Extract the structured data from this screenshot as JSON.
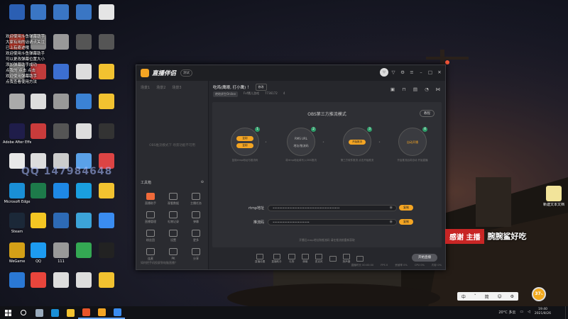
{
  "desktop": {
    "icons_col1": [
      {
        "label": "",
        "color": "#2b5fb3"
      },
      {
        "label": "",
        "color": "#c0392b"
      },
      {
        "label": "",
        "color": "#888"
      },
      {
        "label": "",
        "color": "#aaa"
      },
      {
        "label": "Adobe After Effects 2020",
        "color": "#1f1d4a"
      },
      {
        "label": "",
        "color": "#e8e8e8"
      },
      {
        "label": "Microsoft Edge",
        "color": "#1a8fd6"
      },
      {
        "label": "Steam",
        "color": "#1b2838"
      },
      {
        "label": "WeGame",
        "color": "#d4a017"
      },
      {
        "label": "",
        "color": "#2a78d4"
      }
    ],
    "icons_col2": [
      {
        "label": "",
        "color": "#3a76c4"
      },
      {
        "label": "",
        "color": "#888"
      },
      {
        "label": "",
        "color": "#c13b3b"
      },
      {
        "label": "",
        "color": "#ddd"
      },
      {
        "label": "",
        "color": "#c93b3b"
      },
      {
        "label": "",
        "color": "#ddd"
      },
      {
        "label": "",
        "color": "#1d7a4a"
      },
      {
        "label": "",
        "color": "#f3c623"
      },
      {
        "label": "QQ",
        "color": "#1d9bf0"
      },
      {
        "label": "",
        "color": "#e8453c"
      }
    ],
    "icons_col3": [
      {
        "label": "",
        "color": "#3a76c4"
      },
      {
        "label": "",
        "color": "#999"
      },
      {
        "label": "",
        "color": "#3c6fd1"
      },
      {
        "label": "",
        "color": "#999"
      },
      {
        "label": "",
        "color": "#555"
      },
      {
        "label": "",
        "color": "#ccc"
      },
      {
        "label": "",
        "color": "#1e88e5"
      },
      {
        "label": "",
        "color": "#2d6ab5"
      },
      {
        "label": "111",
        "color": "#999"
      },
      {
        "label": "",
        "color": "#ddd"
      }
    ],
    "icons_col4": [
      {
        "label": "",
        "color": "#3a76c4"
      },
      {
        "label": "",
        "color": "#555"
      },
      {
        "label": "",
        "color": "#ddd"
      },
      {
        "label": "",
        "color": "#3b82d4"
      },
      {
        "label": "",
        "color": "#ddd"
      },
      {
        "label": "",
        "color": "#5aa1e8"
      },
      {
        "label": "",
        "color": "#1a9fe0"
      },
      {
        "label": "",
        "color": "#3ca3d8"
      },
      {
        "label": "",
        "color": "#34a853"
      },
      {
        "label": "",
        "color": "#ddd"
      }
    ],
    "icons_col5": [
      {
        "label": "",
        "color": "#e5e5e5"
      },
      {
        "label": "",
        "color": "#555"
      },
      {
        "label": "",
        "color": "#f2c230"
      },
      {
        "label": "",
        "color": "#f2c230"
      },
      {
        "label": "",
        "color": "#333"
      },
      {
        "label": "",
        "color": "#d44"
      },
      {
        "label": "",
        "color": "#f2c230"
      },
      {
        "label": "",
        "color": "#3a8cf0"
      },
      {
        "label": "",
        "color": "#222"
      },
      {
        "label": "",
        "color": "#f2c230"
      }
    ],
    "notes": [
      "欢迎使用斗鱼弹幕助手",
      "大家有用的话请点关注",
      "已上有奇迹哦",
      "欢迎使用斗鱼弹幕助手",
      "可以更改弹幕位置大小",
      "添加弹幕助手成功",
      "点我的 点击 点击",
      "欢迎使用弹幕助手",
      "点我查看使用方法"
    ],
    "qq_watermark": "QQ 147984648",
    "right_folder_label": "新建文本文档"
  },
  "app": {
    "logo_text": "直播伴侣",
    "version": "测试",
    "scene_tabs": [
      "场景1",
      "场景2",
      "场景3"
    ],
    "scene_empty": "OBS推流模式下 场景功能不可用",
    "tools_header": "工具箱",
    "tools": [
      {
        "label": "直播助手",
        "hot": true
      },
      {
        "label": "观看数据",
        "hot": false
      },
      {
        "label": "主播任务",
        "hot": false
      },
      {
        "label": "直播管理",
        "hot": false
      },
      {
        "label": "礼物记录",
        "hot": false
      },
      {
        "label": "弹幕",
        "hot": false
      },
      {
        "label": "粉丝团",
        "hot": false
      },
      {
        "label": "设置",
        "hot": false
      },
      {
        "label": "更多",
        "hot": false
      },
      {
        "label": "连麦",
        "hot": false
      },
      {
        "label": "PK",
        "hot": false
      },
      {
        "label": "分享",
        "hot": false
      }
    ],
    "left_footer": "如何把手机投屏到电脑直播？",
    "room_title": "吃鸡(鹰眼, 打小鹰) ！",
    "room_edit": "修改",
    "room_meta": {
      "game": "绝地求生Online",
      "room_label": "Fxf鹰儿游戏",
      "room_id": "7736172",
      "fans": "4"
    },
    "obs_title": "OBS第三方推流模式",
    "tutorial_btn": "教程",
    "steps": [
      {
        "num": "1",
        "pills": [
          "复制",
          "复制"
        ],
        "caption": "复制rtmp地址与推流码"
      },
      {
        "num": "2",
        "text_top": "RMS URL",
        "text_bottom": "地址/推流码",
        "caption": "将rtmp地址填写入OBS推流"
      },
      {
        "num": "3",
        "pills": [
          "开始推流"
        ],
        "caption": "第三方软件推流 点击开始推流"
      },
      {
        "num": "4",
        "text_top": "自动开播",
        "caption": "开启推流后将自动 开始直播"
      }
    ],
    "rtmp_label": "rtmp地址",
    "rtmp_value": "••••••••••••••••••••••••••••••••••••••••",
    "stream_key_label": "推流码",
    "stream_key_value": "••••••••••••••••••••••",
    "copy_label": "复制",
    "rtmp_hint": "开播后rtmp地址和推流码 请在推流前重新获取",
    "bottom_tools": [
      "直播设置",
      "直播助手",
      "礼物",
      "弹幕",
      "麦克风",
      "",
      "扬声器",
      ""
    ],
    "start_live": "开始直播",
    "stats": [
      "直播时长 00:00:00",
      "FPS 0",
      "丢帧率 0%",
      "CPU 0%",
      "内存 0%"
    ]
  },
  "overlay": {
    "danmu_red": "感谢 主播",
    "danmu_white": "腕腕鲨好吃"
  },
  "ime": {
    "items": [
      "中",
      "ˇ",
      "简",
      "☺",
      "⚙"
    ]
  },
  "speed_ball": {
    "value": "37",
    "unit": "%"
  },
  "taskbar": {
    "apps": [
      {
        "name": "search",
        "color": "#ffffff"
      },
      {
        "name": "task-view",
        "color": "#9ab"
      },
      {
        "name": "edge",
        "color": "#1a8fd6"
      },
      {
        "name": "explorer",
        "color": "#f2c230"
      },
      {
        "name": "app-orange",
        "color": "#e8552a"
      },
      {
        "name": "app-yellow",
        "color": "#f4a523"
      },
      {
        "name": "app-blue",
        "color": "#3a8cf0"
      }
    ],
    "weather": "20°C 多云",
    "time": "19:40",
    "date": "2021/8/26"
  }
}
